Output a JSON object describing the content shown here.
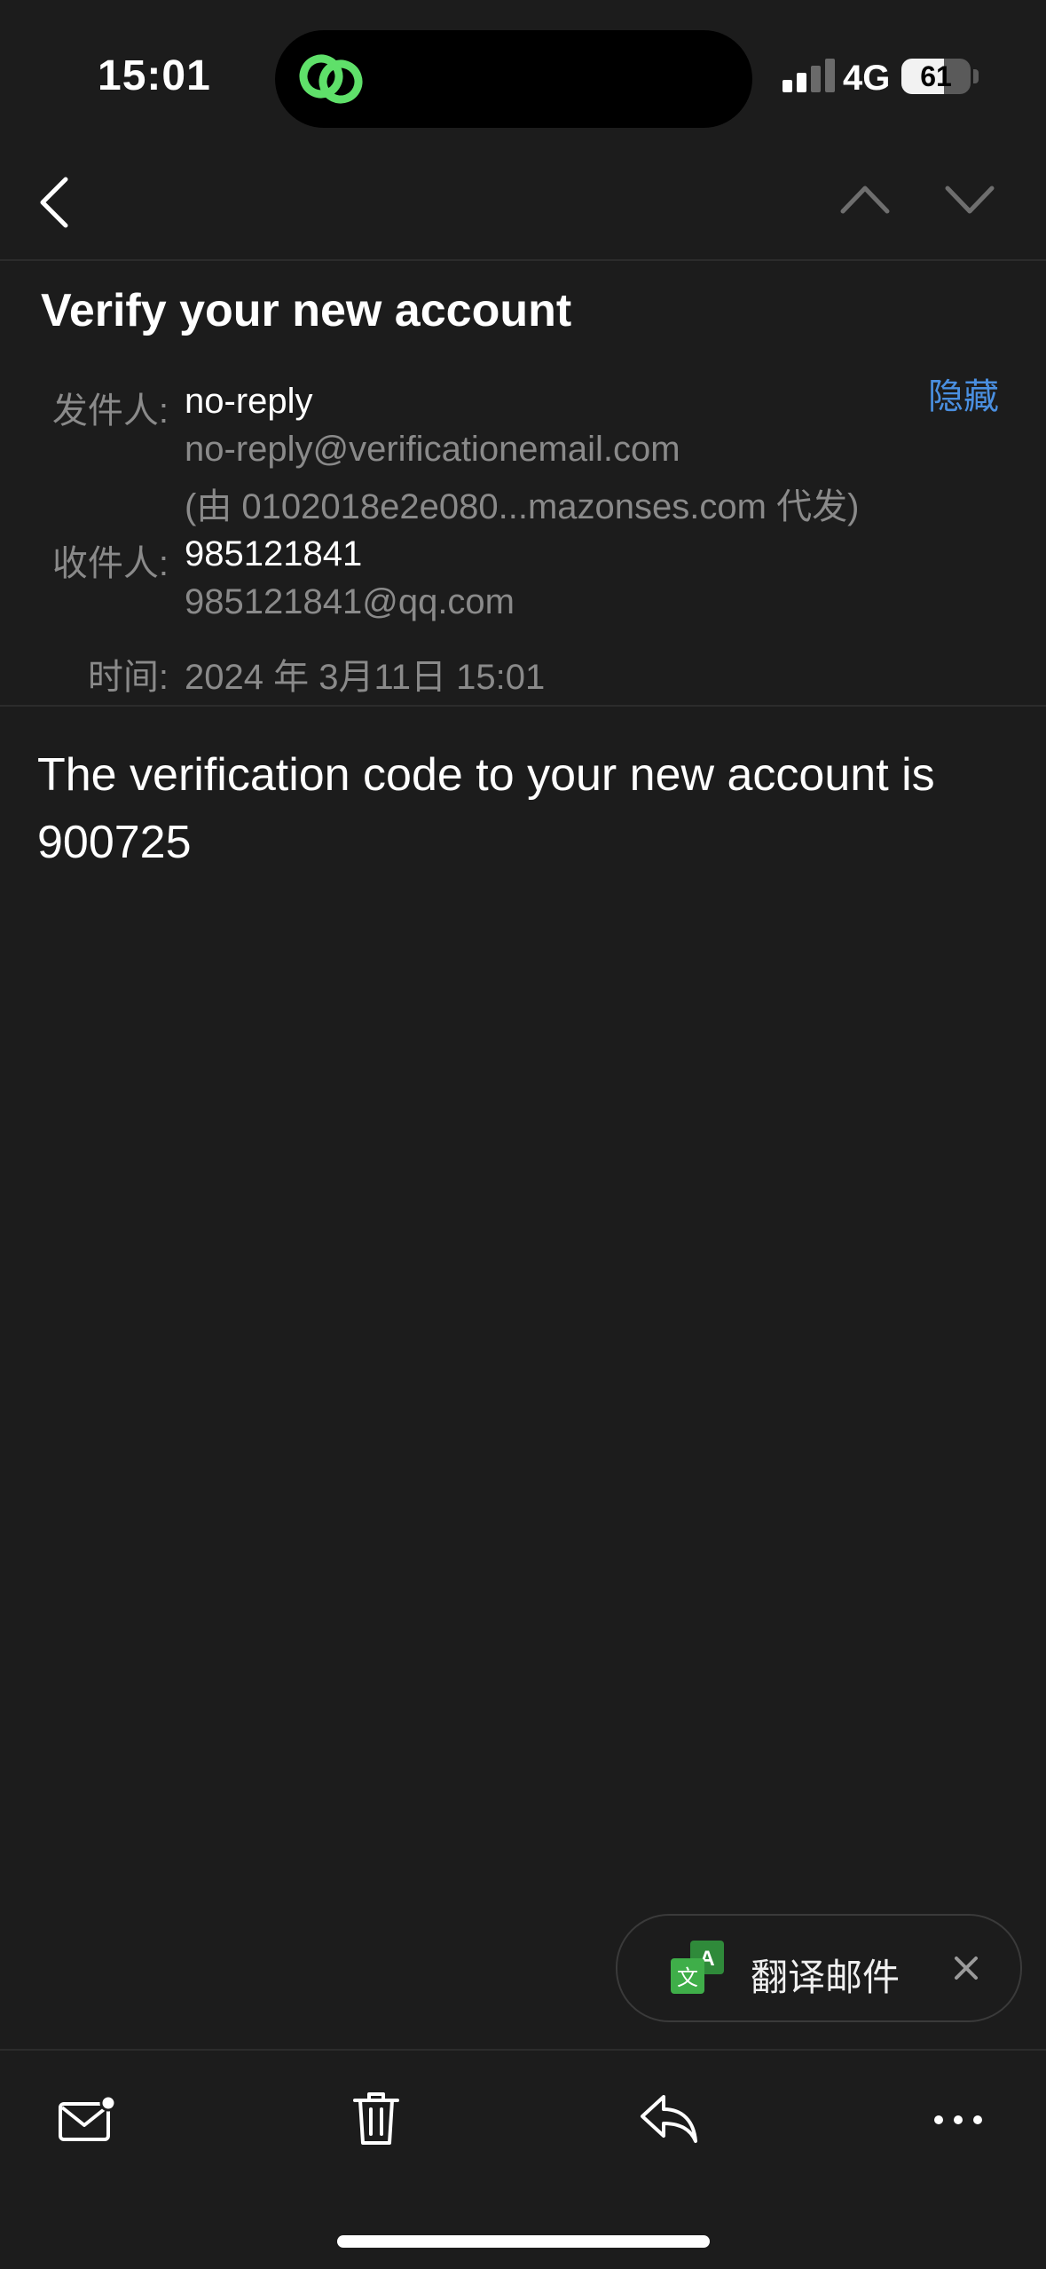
{
  "status_bar": {
    "time": "15:01",
    "network": "4G",
    "battery": "61",
    "battery_level": 0.61,
    "signal_bars_active": 2,
    "signal_bars_total": 4,
    "island_icon": "link-icon"
  },
  "nav": {
    "back_icon": "chevron-left-icon",
    "prev_icon": "chevron-up-icon",
    "next_icon": "chevron-down-icon"
  },
  "email": {
    "subject": "Verify your new account",
    "from_label": "发件人:",
    "from_name": "no-reply",
    "from_address": "no-reply@verificationemail.com",
    "from_via": "(由 0102018e2e080...mazonses.com 代发)",
    "hide_label": "隐藏",
    "to_label": "收件人:",
    "to_name": "985121841",
    "to_address": "985121841@qq.com",
    "time_label": "时间:",
    "time_value": "2024 年 3月11日 15:01",
    "body_line1": "The verification code to your new account is",
    "body_line2": "900725"
  },
  "translate_banner": {
    "label": "翻译邮件",
    "icon": "translate-icon",
    "close_icon": "close-icon"
  },
  "toolbar": {
    "mail_icon": "mail-unread-icon",
    "delete_icon": "trash-icon",
    "reply_icon": "reply-icon",
    "more_icon": "more-icon"
  },
  "colors": {
    "background": "#1c1c1c",
    "accent_link": "#4a8fe0",
    "island_green": "#5fe06a",
    "translate_green": "#3fae49"
  }
}
